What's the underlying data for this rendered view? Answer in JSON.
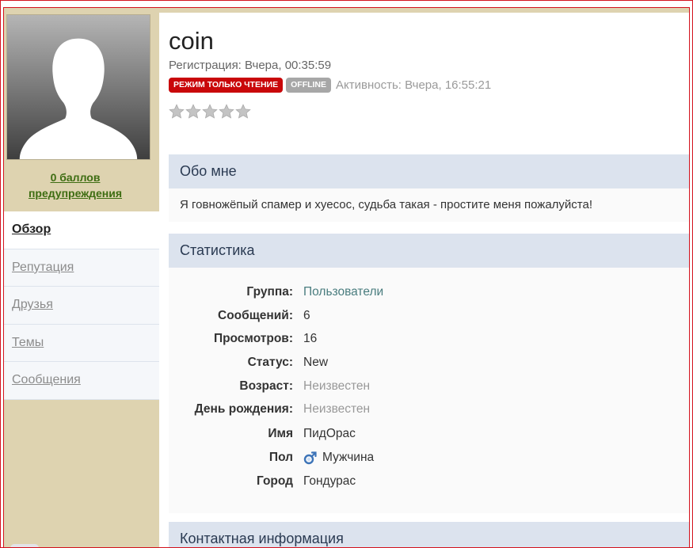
{
  "profile": {
    "username": "coin",
    "registration": "Регистрация: Вчера, 00:35:59",
    "badge_readonly": "РЕЖИМ ТОЛЬКО ЧТЕНИЕ",
    "badge_offline": "OFFLINE",
    "activity": "Активность: Вчера, 16:55:21",
    "rating_stars": 0,
    "rating_max": 5
  },
  "sidebar": {
    "warnings_link": "0 баллов предупреждения",
    "tabs": [
      {
        "label": "Обзор",
        "active": true
      },
      {
        "label": "Репутация",
        "active": false
      },
      {
        "label": "Друзья",
        "active": false
      },
      {
        "label": "Темы",
        "active": false
      },
      {
        "label": "Сообщения",
        "active": false
      }
    ]
  },
  "about": {
    "title": "Обо мне",
    "text": "Я говножёпый спамер и хуесос, судьба такая - простите меня пожалуйста!"
  },
  "stats": {
    "title": "Статистика",
    "rows": [
      {
        "label": "Группа:",
        "value": "Пользователи"
      },
      {
        "label": "Сообщений:",
        "value": "6"
      },
      {
        "label": "Просмотров:",
        "value": "16"
      },
      {
        "label": "Статус:",
        "value": "New"
      },
      {
        "label": "Возраст:",
        "value": "Неизвестен"
      },
      {
        "label": "День рождения:",
        "value": "Неизвестен"
      },
      {
        "label": "Имя",
        "value": "ПидОрас"
      },
      {
        "label": "Пол",
        "value": "Мужчина",
        "icon": "male-icon"
      },
      {
        "label": "Город",
        "value": "Гондурас"
      }
    ]
  },
  "contacts": {
    "title": "Контактная информация"
  },
  "colors": {
    "frame_border": "#d3121d",
    "sidebar_bg": "#ded3b0",
    "section_head_bg": "#dce3ee",
    "badge_red": "#c9070a",
    "badge_grey": "#a7a7a7",
    "link_green": "#3e6d12",
    "link_teal": "#4a7d7f"
  }
}
